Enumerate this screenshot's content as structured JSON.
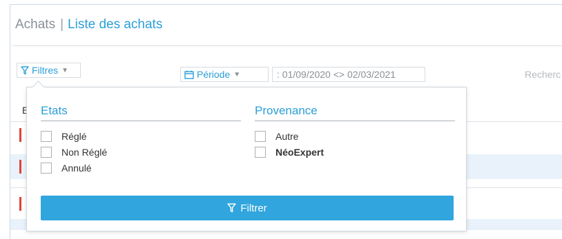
{
  "header": {
    "section": "Achats",
    "separator": "|",
    "current": "Liste des achats"
  },
  "toolbar": {
    "filters_label": "Filtres",
    "period_label": "Période",
    "period_value": ": 01/09/2020 <> 02/03/2021",
    "search_placeholder": "Recherc"
  },
  "table": {
    "first_column_letter": "E"
  },
  "filters_panel": {
    "groups": [
      {
        "title": "Etats",
        "options": [
          {
            "label": "Réglé",
            "checked": false
          },
          {
            "label": "Non Réglé",
            "checked": false
          },
          {
            "label": "Annulé",
            "checked": false
          }
        ]
      },
      {
        "title": "Provenance",
        "options": [
          {
            "label": "Autre",
            "checked": false
          },
          {
            "label": "NéoExpert",
            "checked": false
          }
        ]
      }
    ],
    "apply_label": "Filtrer"
  },
  "colors": {
    "accent": "#2a9fd6",
    "button_bg": "#31a5dd",
    "row_stripe": "#e9f2fa",
    "status_marker": "#e2413a"
  },
  "icons": {
    "filter": "filter-funnel-icon",
    "calendar": "calendar-icon",
    "caret": "caret-down-icon"
  }
}
